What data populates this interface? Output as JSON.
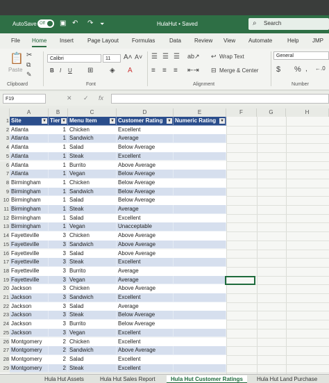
{
  "titlebar": {
    "autosave_label": "AutoSave",
    "autosave_state": "Off",
    "doc_title": "HulaHut • Saved",
    "search_placeholder": "Search"
  },
  "ribbon_tabs": [
    "File",
    "Home",
    "Insert",
    "Page Layout",
    "Formulas",
    "Data",
    "Review",
    "View",
    "Automate",
    "Help",
    "JMP"
  ],
  "active_tab": "Home",
  "ribbon": {
    "paste_label": "Paste",
    "clipboard_label": "Clipboard",
    "font_name": "Calibri",
    "font_size": "11",
    "font_group_label": "Font",
    "wrap_text_label": "Wrap Text",
    "merge_center_label": "Merge & Center",
    "alignment_label": "Alignment",
    "number_format": "General",
    "number_label": "Number",
    "currency_symbol": "$",
    "percent_symbol": "%"
  },
  "formula_bar": {
    "name_box": "F19",
    "cancel_glyph": "✕",
    "enter_glyph": "✓",
    "fx_label": "fx"
  },
  "columns": [
    "A",
    "B",
    "C",
    "D",
    "E",
    "F",
    "G",
    "H"
  ],
  "table": {
    "headers": [
      "Site",
      "Tier",
      "Menu Item",
      "Customer Rating",
      "Numeric Rating"
    ],
    "rows": [
      [
        "Atlanta",
        "1",
        "Chicken",
        "Excellent"
      ],
      [
        "Atlanta",
        "1",
        "Sandwich",
        "Average"
      ],
      [
        "Atlanta",
        "1",
        "Salad",
        "Below Average"
      ],
      [
        "Atlanta",
        "1",
        "Steak",
        "Excellent"
      ],
      [
        "Atlanta",
        "1",
        "Burrito",
        "Above Average"
      ],
      [
        "Atlanta",
        "1",
        "Vegan",
        "Below Average"
      ],
      [
        "Birmingham",
        "1",
        "Chicken",
        "Below Average"
      ],
      [
        "Birmingham",
        "1",
        "Sandwich",
        "Below Average"
      ],
      [
        "Birmingham",
        "1",
        "Salad",
        "Below Average"
      ],
      [
        "Birmingham",
        "1",
        "Steak",
        "Average"
      ],
      [
        "Birmingham",
        "1",
        "Salad",
        "Excellent"
      ],
      [
        "Birmingham",
        "1",
        "Vegan",
        "Unacceptable"
      ],
      [
        "Fayetteville",
        "3",
        "Chicken",
        "Above Average"
      ],
      [
        "Fayetteville",
        "3",
        "Sandwich",
        "Above Average"
      ],
      [
        "Fayetteville",
        "3",
        "Salad",
        "Above Average"
      ],
      [
        "Fayetteville",
        "3",
        "Steak",
        "Excellent"
      ],
      [
        "Fayetteville",
        "3",
        "Burrito",
        "Average"
      ],
      [
        "Fayetteville",
        "3",
        "Vegan",
        "Average"
      ],
      [
        "Jackson",
        "3",
        "Chicken",
        "Above Average"
      ],
      [
        "Jackson",
        "3",
        "Sandwich",
        "Excellent"
      ],
      [
        "Jackson",
        "3",
        "Salad",
        "Average"
      ],
      [
        "Jackson",
        "3",
        "Steak",
        "Below Average"
      ],
      [
        "Jackson",
        "3",
        "Burrito",
        "Below Average"
      ],
      [
        "Jackson",
        "3",
        "Vegan",
        "Excellent"
      ],
      [
        "Montgomery",
        "2",
        "Chicken",
        "Excellent"
      ],
      [
        "Montgomery",
        "2",
        "Sandwich",
        "Above Average"
      ],
      [
        "Montgomery",
        "2",
        "Salad",
        "Excellent"
      ],
      [
        "Montgomery",
        "2",
        "Steak",
        "Excellent"
      ]
    ]
  },
  "row_numbers": [
    "1",
    "2",
    "3",
    "4",
    "5",
    "6",
    "7",
    "8",
    "9",
    "10",
    "11",
    "12",
    "13",
    "14",
    "15",
    "16",
    "17",
    "18",
    "19",
    "20",
    "21",
    "22",
    "23",
    "24",
    "25",
    "26",
    "27",
    "28",
    "29"
  ],
  "sheet_tabs": [
    "Hula Hut Assets",
    "Hula Hut Sales Report",
    "Hula Hut Customer Ratings",
    "Hula Hut Land Purchase"
  ],
  "active_sheet": "Hula Hut Customer Ratings",
  "colors": {
    "title_green": "#2e6f45",
    "table_header": "#2b4e8c",
    "band": "#d6dfee"
  }
}
